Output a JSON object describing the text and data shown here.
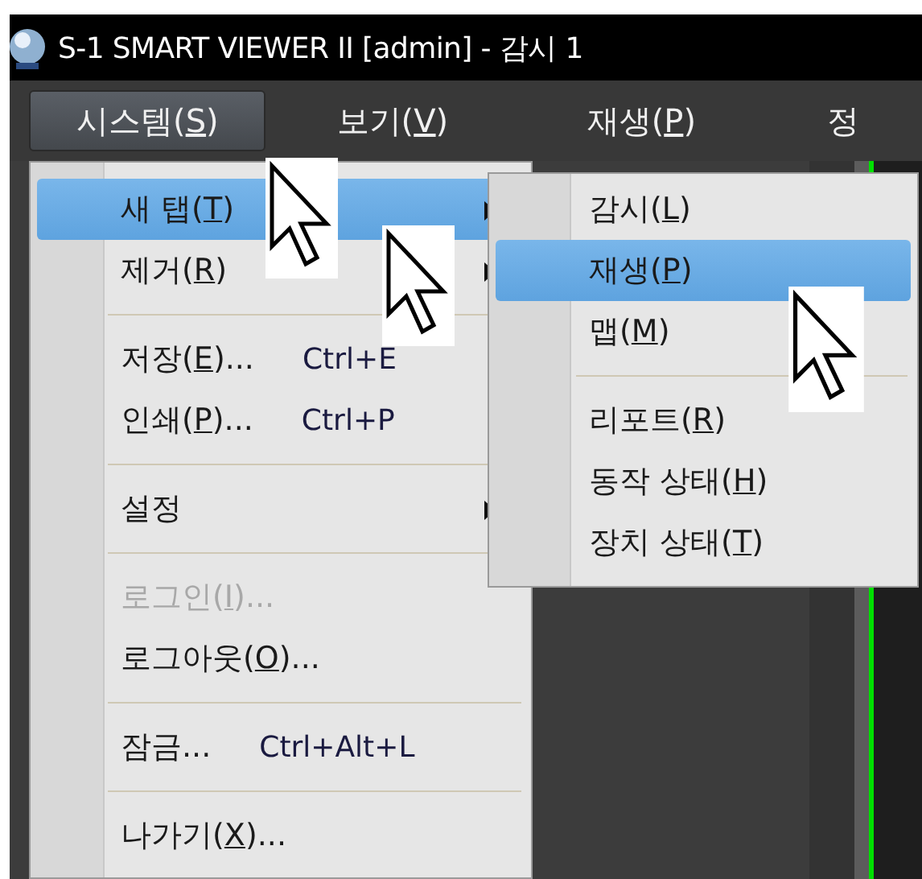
{
  "window": {
    "title": "S-1 SMART VIEWER II [admin] - 감시 1"
  },
  "menubar": [
    {
      "label": "시스템(S)",
      "selected": true
    },
    {
      "label": "보기(V)",
      "selected": false
    },
    {
      "label": "재생(P)",
      "selected": false
    },
    {
      "label": "정",
      "selected": false
    }
  ],
  "menu": [
    {
      "kind": "item",
      "label": "새 탭(T)",
      "submenu": true,
      "selected": true,
      "disabled": false
    },
    {
      "kind": "item",
      "label": "제거(R)",
      "submenu": true,
      "selected": false,
      "disabled": false
    },
    {
      "kind": "separator"
    },
    {
      "kind": "item",
      "label": "저장(E)...",
      "shortcut": "Ctrl+E",
      "submenu": false,
      "selected": false,
      "disabled": false
    },
    {
      "kind": "item",
      "label": "인쇄(P)...",
      "shortcut": "Ctrl+P",
      "submenu": false,
      "selected": false,
      "disabled": false
    },
    {
      "kind": "separator"
    },
    {
      "kind": "item",
      "label": "설정",
      "submenu": true,
      "selected": false,
      "disabled": false
    },
    {
      "kind": "separator"
    },
    {
      "kind": "item",
      "label": "로그인(I)...",
      "submenu": false,
      "selected": false,
      "disabled": true
    },
    {
      "kind": "item",
      "label": "로그아웃(O)...",
      "submenu": false,
      "selected": false,
      "disabled": false
    },
    {
      "kind": "separator"
    },
    {
      "kind": "item",
      "label": "잠금...",
      "shortcut": "Ctrl+Alt+L",
      "submenu": false,
      "selected": false,
      "disabled": false
    },
    {
      "kind": "separator"
    },
    {
      "kind": "item",
      "label": "나가기(X)...",
      "submenu": false,
      "selected": false,
      "disabled": false
    }
  ],
  "submenu": [
    {
      "kind": "item",
      "label": "감시(L)",
      "selected": false
    },
    {
      "kind": "item",
      "label": "재생(P)",
      "selected": true
    },
    {
      "kind": "item",
      "label": "맵(M)",
      "selected": false
    },
    {
      "kind": "separator"
    },
    {
      "kind": "item",
      "label": "리포트(R)",
      "selected": false
    },
    {
      "kind": "item",
      "label": "동작 상태(H)",
      "selected": false
    },
    {
      "kind": "item",
      "label": "장치 상태(T)",
      "selected": false
    }
  ]
}
